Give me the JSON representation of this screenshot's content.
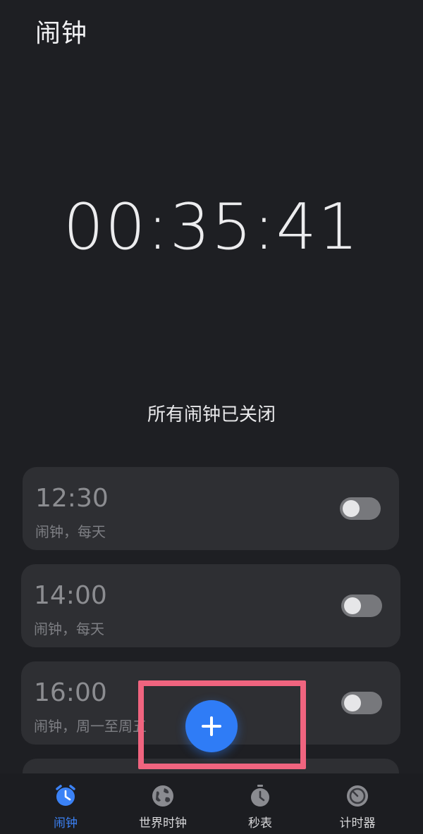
{
  "header": {
    "title": "闹钟"
  },
  "clock": {
    "time": "00:35:41"
  },
  "status": {
    "message": "所有闹钟已关闭"
  },
  "alarms": [
    {
      "time": "12:30",
      "subtitle": "闹钟，每天",
      "enabled": false
    },
    {
      "time": "14:00",
      "subtitle": "闹钟，每天",
      "enabled": false
    },
    {
      "time": "16:00",
      "subtitle": "闹钟，周一至周五",
      "enabled": false
    }
  ],
  "fab": {
    "icon": "plus-icon"
  },
  "bottom_nav": {
    "items": [
      {
        "label": "闹钟",
        "icon": "alarm-clock-icon",
        "active": true
      },
      {
        "label": "世界时钟",
        "icon": "globe-icon",
        "active": false
      },
      {
        "label": "秒表",
        "icon": "stopwatch-icon",
        "active": false
      },
      {
        "label": "计时器",
        "icon": "timer-icon",
        "active": false
      }
    ]
  },
  "colors": {
    "background": "#1e1f23",
    "card": "#2e2f33",
    "accent": "#2f7cf6",
    "highlight": "#f0647f"
  }
}
